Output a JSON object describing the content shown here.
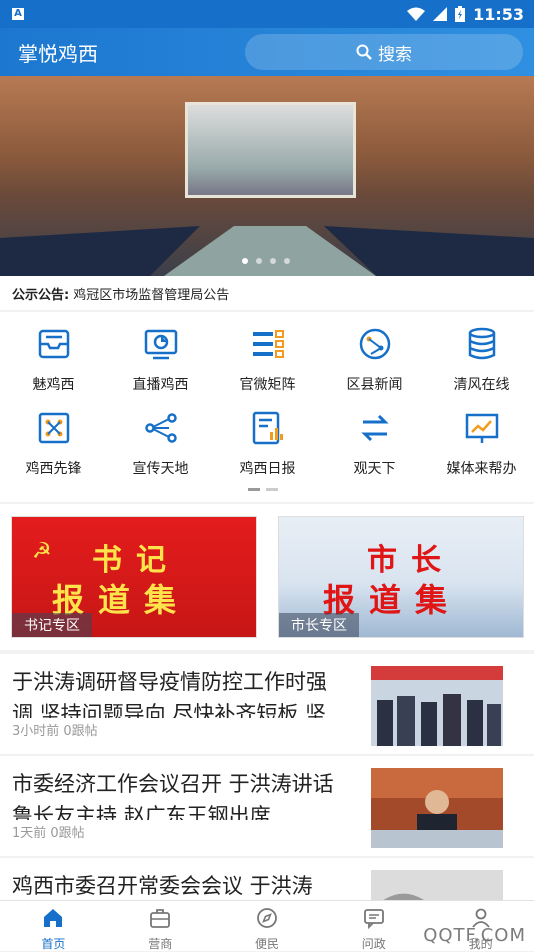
{
  "status_bar": {
    "time": "11:53"
  },
  "header": {
    "title": "掌悦鸡西",
    "search_label": "搜索"
  },
  "notice": {
    "label": "公示公告:",
    "text": "鸡冠区市场监督管理局公告"
  },
  "grid": [
    {
      "label": "魅鸡西",
      "icon": "inbox-icon"
    },
    {
      "label": "直播鸡西",
      "icon": "monitor-chart-icon"
    },
    {
      "label": "官微矩阵",
      "icon": "list-grid-icon"
    },
    {
      "label": "区县新闻",
      "icon": "network-globe-icon"
    },
    {
      "label": "清风在线",
      "icon": "database-icon"
    },
    {
      "label": "鸡西先锋",
      "icon": "nodes-icon"
    },
    {
      "label": "宣传天地",
      "icon": "share-icon"
    },
    {
      "label": "鸡西日报",
      "icon": "newspaper-icon"
    },
    {
      "label": "观天下",
      "icon": "swap-icon"
    },
    {
      "label": "媒体来帮办",
      "icon": "presentation-icon"
    }
  ],
  "cards": [
    {
      "line1": "书记",
      "line2": "报道集",
      "tag": "书记专区"
    },
    {
      "line1": "市长",
      "line2": "报道集",
      "tag": "市长专区"
    }
  ],
  "news": [
    {
      "title": "于洪涛调研督导疫情防控工作时强调 坚持问题导向 尽快补齐短板 坚",
      "meta": "3小时前  0跟帖"
    },
    {
      "title": "市委经济工作会议召开 于洪涛讲话 鲁长友主持 赵广东王钢出席",
      "meta": "1天前  0跟帖"
    },
    {
      "title": "鸡西市委召开常委会会议 于洪涛",
      "meta": ""
    }
  ],
  "tabs": [
    {
      "label": "首页",
      "icon": "home-icon"
    },
    {
      "label": "营商",
      "icon": "briefcase-icon"
    },
    {
      "label": "便民",
      "icon": "compass-icon"
    },
    {
      "label": "问政",
      "icon": "chat-icon"
    },
    {
      "label": "我的",
      "icon": "user-icon"
    }
  ],
  "watermark": "QQTF.COM",
  "colors": {
    "brand": "#1670c9",
    "red": "#e41c1c"
  }
}
